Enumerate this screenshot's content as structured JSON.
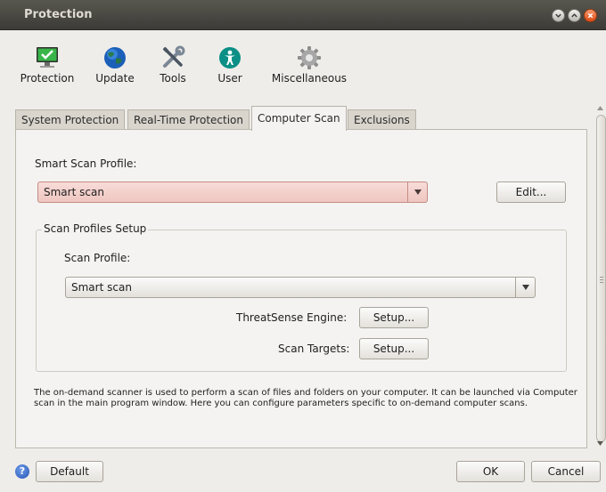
{
  "window": {
    "title": "Protection"
  },
  "toolbar": {
    "items": [
      {
        "label": "Protection",
        "icon": "monitor-check-icon"
      },
      {
        "label": "Update",
        "icon": "globe-icon"
      },
      {
        "label": "Tools",
        "icon": "tools-icon"
      },
      {
        "label": "User",
        "icon": "user-icon"
      },
      {
        "label": "Miscellaneous",
        "icon": "gear-icon"
      }
    ]
  },
  "tabs": [
    {
      "label": "System Protection",
      "active": false
    },
    {
      "label": "Real-Time Protection",
      "active": false
    },
    {
      "label": "Computer Scan",
      "active": true
    },
    {
      "label": "Exclusions",
      "active": false
    }
  ],
  "computer_scan": {
    "smart_profile_label": "Smart Scan Profile:",
    "smart_profile_value": "Smart scan",
    "edit_label": "Edit...",
    "setup_group_title": "Scan Profiles Setup",
    "scan_profile_label": "Scan Profile:",
    "scan_profile_value": "Smart scan",
    "threatsense_label": "ThreatSense Engine:",
    "threatsense_button": "Setup...",
    "targets_label": "Scan Targets:",
    "targets_button": "Setup...",
    "description": "The on-demand scanner is used to perform a scan of files and folders on your computer. It can be launched via Computer scan in the main program window. Here you can configure parameters specific to on-demand computer scans."
  },
  "footer": {
    "help_icon_text": "?",
    "default_label": "Default",
    "ok_label": "OK",
    "cancel_label": "Cancel"
  },
  "colors": {
    "highlight_combo": "#f3d3cf",
    "accent_orange": "#df4a12"
  }
}
